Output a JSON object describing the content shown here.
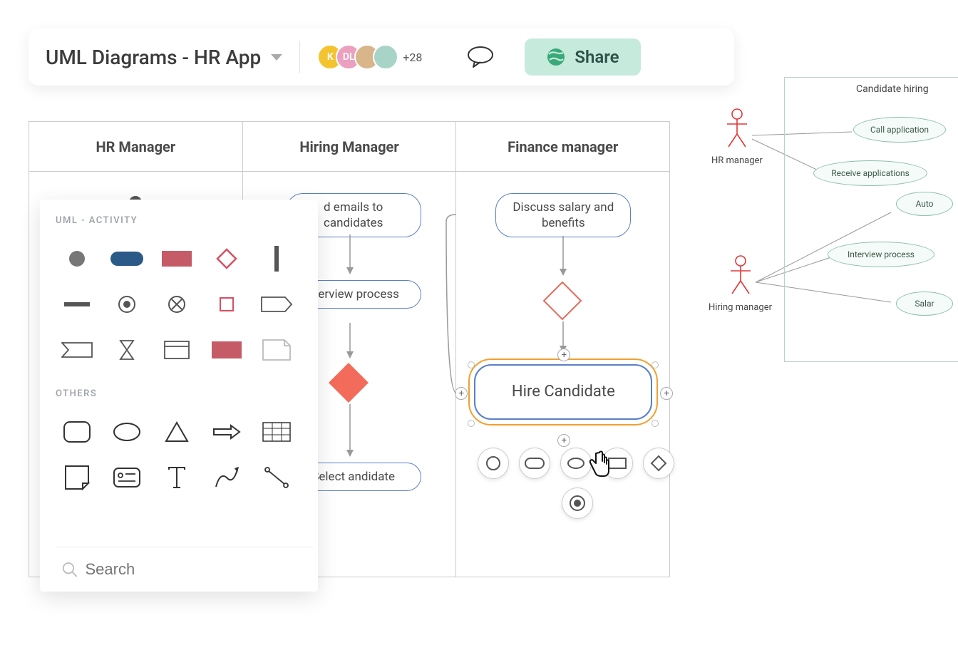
{
  "header": {
    "title": "UML Diagrams - HR App",
    "avatars": [
      {
        "label": "K",
        "color": "#f4c430"
      },
      {
        "label": "DL",
        "color": "#eaa0be"
      },
      {
        "label": "",
        "color": "#d8b58b"
      },
      {
        "label": "",
        "color": "#a8d4c8"
      }
    ],
    "more_count": "+28",
    "share_label": "Share"
  },
  "swimlanes": {
    "lane1_title": "HR Manager",
    "lane2_title": "Hiring Manager",
    "lane3_title": "Finance manager",
    "nodes": {
      "send_emails": "d emails to candidates",
      "interview": "nterview process",
      "select_candidate": "Select andidate",
      "discuss_salary": "Discuss salary and benefits",
      "hire_candidate": "Hire Candidate"
    }
  },
  "palette": {
    "section1": "UML - ACTIVITY",
    "section2": "OTHERS",
    "search_placeholder": "Search"
  },
  "usecase": {
    "title": "Candidate hiring",
    "actor1": "HR manager",
    "actor2": "Hiring manager",
    "cases": {
      "call": "Call application",
      "receive": "Receive applications",
      "auto": "Auto",
      "interview": "Interview process",
      "salary": "Salar"
    }
  }
}
